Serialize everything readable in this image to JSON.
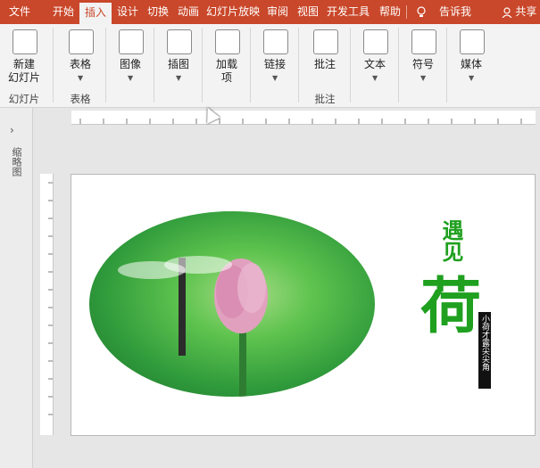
{
  "tabs": [
    {
      "label": "文件",
      "active": false
    },
    {
      "label": "开始",
      "active": false
    },
    {
      "label": "插入",
      "active": true
    },
    {
      "label": "设计",
      "active": false
    },
    {
      "label": "切换",
      "active": false
    },
    {
      "label": "动画",
      "active": false
    },
    {
      "label": "幻灯片放映",
      "active": false
    },
    {
      "label": "审阅",
      "active": false
    },
    {
      "label": "视图",
      "active": false
    },
    {
      "label": "开发工具",
      "active": false
    },
    {
      "label": "帮助",
      "active": false
    }
  ],
  "tellme": "告诉我",
  "share": "共享",
  "ribbon": {
    "buttons": [
      {
        "label": "新建\n幻灯片",
        "icon": "new-slide-icon"
      },
      {
        "label": "表格",
        "icon": "table-icon"
      },
      {
        "label": "图像",
        "icon": "image-icon"
      },
      {
        "label": "插图",
        "icon": "shapes-icon"
      },
      {
        "label": "加载\n项",
        "icon": "addins-icon"
      },
      {
        "label": "链接",
        "icon": "link-icon"
      },
      {
        "label": "批注",
        "icon": "comment-icon"
      },
      {
        "label": "文本",
        "icon": "text-icon"
      },
      {
        "label": "符号",
        "icon": "omega-icon"
      },
      {
        "label": "媒体",
        "icon": "speaker-icon"
      }
    ],
    "groups": [
      "幻灯片",
      "表格",
      "批注"
    ]
  },
  "left_panel": {
    "label": "缩略图"
  },
  "slide": {
    "title_main": "遇见",
    "title_big": "荷",
    "vertical_caption": "小荷才露尖尖角"
  },
  "colors": {
    "accent": "#c9472a",
    "title_green": "#1fa01f"
  }
}
